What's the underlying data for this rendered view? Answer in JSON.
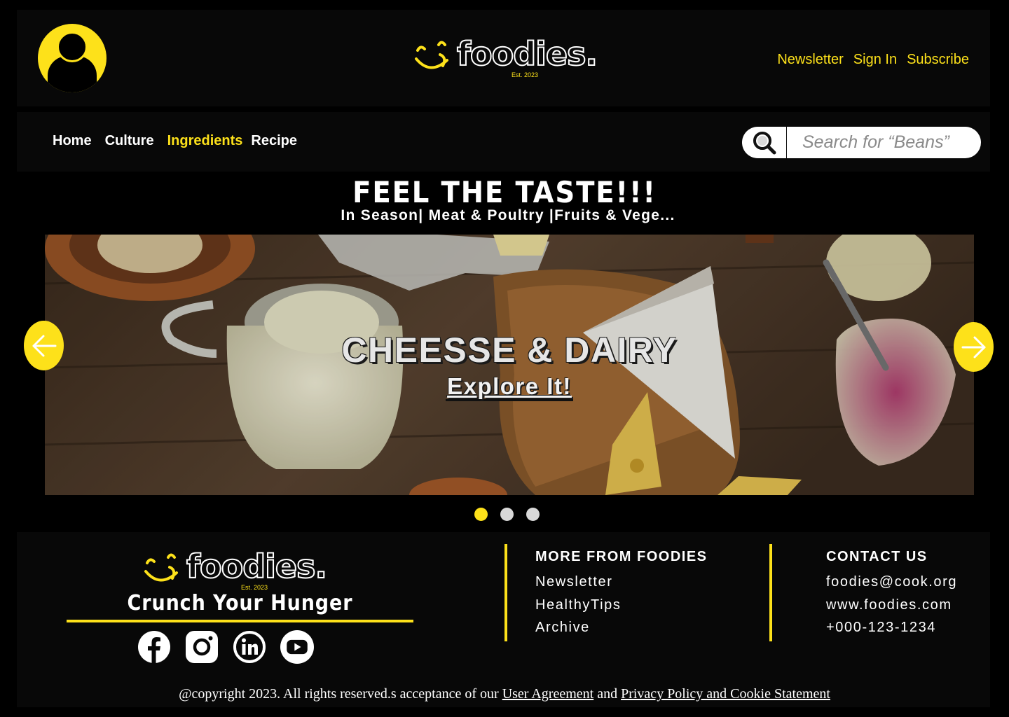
{
  "brand": {
    "name": "foodies.",
    "est": "Est. 2023",
    "accent": "#fde11a"
  },
  "header": {
    "avatar_icon": "user-avatar-icon",
    "links": [
      "Newsletter",
      "Sign In",
      "Subscribe"
    ]
  },
  "nav": {
    "items": [
      {
        "label": "Home",
        "active": false
      },
      {
        "label": "Culture",
        "active": false
      },
      {
        "label": "Ingredients",
        "active": true
      },
      {
        "label": "Recipe",
        "active": false
      }
    ],
    "search": {
      "icon": "search-icon",
      "placeholder": "Search for “Beans”"
    }
  },
  "hero": {
    "title": "FEEL THE TASTE!!!",
    "subtitle": "In Season| Meat & Poultry |Fruits & Vege..."
  },
  "banner": {
    "title": "CHEESSE & DAIRY",
    "cta": "Explore It!",
    "prev_icon": "arrow-left-icon",
    "next_icon": "arrow-right-icon",
    "slide_count": 3,
    "active_slide": 1
  },
  "footer": {
    "tagline": "Crunch Your Hunger",
    "socials": [
      "facebook-icon",
      "instagram-icon",
      "linkedin-icon",
      "youtube-icon"
    ],
    "more": {
      "heading": "MORE FROM FOODIES",
      "links": [
        "Newsletter",
        "HealthyTips",
        "Archive"
      ]
    },
    "contact": {
      "heading": "CONTACT US",
      "items": [
        "foodies@cook.org",
        "www.foodies.com",
        "+000-123-1234"
      ]
    },
    "copyright": {
      "text": "@copyright 2023. All rights reserved.s acceptance of our ",
      "link1": "User Agreement",
      "and": " and ",
      "link2": "Privacy Policy and Cookie Statement"
    }
  }
}
